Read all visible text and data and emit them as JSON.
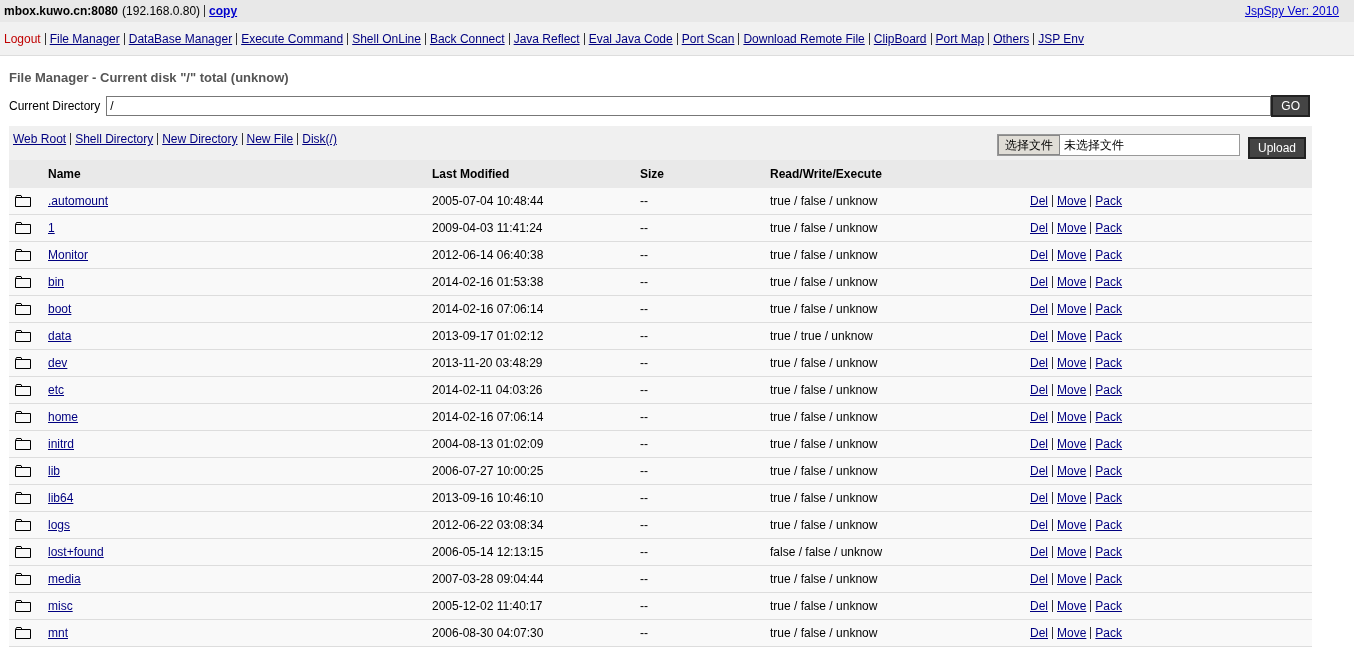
{
  "header": {
    "host": "mbox.kuwo.cn:8080",
    "ip": "(192.168.0.80)",
    "copy_link": "copy",
    "version_link": "JspSpy Ver: 2010"
  },
  "nav": [
    {
      "label": "Logout",
      "kind": "logout"
    },
    {
      "label": "File Manager",
      "kind": "link"
    },
    {
      "label": "DataBase Manager",
      "kind": "link"
    },
    {
      "label": "Execute Command",
      "kind": "link"
    },
    {
      "label": "Shell OnLine",
      "kind": "link"
    },
    {
      "label": "Back Connect",
      "kind": "link"
    },
    {
      "label": "Java Reflect",
      "kind": "link"
    },
    {
      "label": "Eval Java Code",
      "kind": "link"
    },
    {
      "label": "Port Scan",
      "kind": "link"
    },
    {
      "label": "Download Remote File",
      "kind": "link"
    },
    {
      "label": "ClipBoard",
      "kind": "link"
    },
    {
      "label": "Port Map",
      "kind": "link"
    },
    {
      "label": "Others",
      "kind": "link"
    },
    {
      "label": "JSP Env",
      "kind": "link"
    }
  ],
  "title": "File Manager - Current disk \"/\" total (unknow)",
  "directory": {
    "label": "Current Directory",
    "value": "/",
    "go_button": "GO"
  },
  "toolbar_links": [
    "Web Root",
    "Shell Directory",
    "New Directory",
    "New File",
    "Disk(/)"
  ],
  "upload": {
    "choose_button": "选择文件",
    "file_status": "未选择文件",
    "upload_button": "Upload"
  },
  "table": {
    "columns": [
      "Name",
      "Last Modified",
      "Size",
      "Read/Write/Execute"
    ],
    "rows": [
      {
        "name": ".automount",
        "modified": "2005-07-04 10:48:44",
        "size": "--",
        "rwx": "true / false / unknow",
        "actions": [
          "Del",
          "Move",
          "Pack"
        ]
      },
      {
        "name": "1",
        "modified": "2009-04-03 11:41:24",
        "size": "--",
        "rwx": "true / false / unknow",
        "actions": [
          "Del",
          "Move",
          "Pack"
        ]
      },
      {
        "name": "Monitor",
        "modified": "2012-06-14 06:40:38",
        "size": "--",
        "rwx": "true / false / unknow",
        "actions": [
          "Del",
          "Move",
          "Pack"
        ]
      },
      {
        "name": "bin",
        "modified": "2014-02-16 01:53:38",
        "size": "--",
        "rwx": "true / false / unknow",
        "actions": [
          "Del",
          "Move",
          "Pack"
        ]
      },
      {
        "name": "boot",
        "modified": "2014-02-16 07:06:14",
        "size": "--",
        "rwx": "true / false / unknow",
        "actions": [
          "Del",
          "Move",
          "Pack"
        ]
      },
      {
        "name": "data",
        "modified": "2013-09-17 01:02:12",
        "size": "--",
        "rwx": "true / true / unknow",
        "actions": [
          "Del",
          "Move",
          "Pack"
        ]
      },
      {
        "name": "dev",
        "modified": "2013-11-20 03:48:29",
        "size": "--",
        "rwx": "true / false / unknow",
        "actions": [
          "Del",
          "Move",
          "Pack"
        ]
      },
      {
        "name": "etc",
        "modified": "2014-02-11 04:03:26",
        "size": "--",
        "rwx": "true / false / unknow",
        "actions": [
          "Del",
          "Move",
          "Pack"
        ]
      },
      {
        "name": "home",
        "modified": "2014-02-16 07:06:14",
        "size": "--",
        "rwx": "true / false / unknow",
        "actions": [
          "Del",
          "Move",
          "Pack"
        ]
      },
      {
        "name": "initrd",
        "modified": "2004-08-13 01:02:09",
        "size": "--",
        "rwx": "true / false / unknow",
        "actions": [
          "Del",
          "Move",
          "Pack"
        ]
      },
      {
        "name": "lib",
        "modified": "2006-07-27 10:00:25",
        "size": "--",
        "rwx": "true / false / unknow",
        "actions": [
          "Del",
          "Move",
          "Pack"
        ]
      },
      {
        "name": "lib64",
        "modified": "2013-09-16 10:46:10",
        "size": "--",
        "rwx": "true / false / unknow",
        "actions": [
          "Del",
          "Move",
          "Pack"
        ]
      },
      {
        "name": "logs",
        "modified": "2012-06-22 03:08:34",
        "size": "--",
        "rwx": "true / false / unknow",
        "actions": [
          "Del",
          "Move",
          "Pack"
        ]
      },
      {
        "name": "lost+found",
        "modified": "2006-05-14 12:13:15",
        "size": "--",
        "rwx": "false / false / unknow",
        "actions": [
          "Del",
          "Move",
          "Pack"
        ]
      },
      {
        "name": "media",
        "modified": "2007-03-28 09:04:44",
        "size": "--",
        "rwx": "true / false / unknow",
        "actions": [
          "Del",
          "Move",
          "Pack"
        ]
      },
      {
        "name": "misc",
        "modified": "2005-12-02 11:40:17",
        "size": "--",
        "rwx": "true / false / unknow",
        "actions": [
          "Del",
          "Move",
          "Pack"
        ]
      },
      {
        "name": "mnt",
        "modified": "2006-08-30 04:07:30",
        "size": "--",
        "rwx": "true / false / unknow",
        "actions": [
          "Del",
          "Move",
          "Pack"
        ]
      }
    ]
  }
}
